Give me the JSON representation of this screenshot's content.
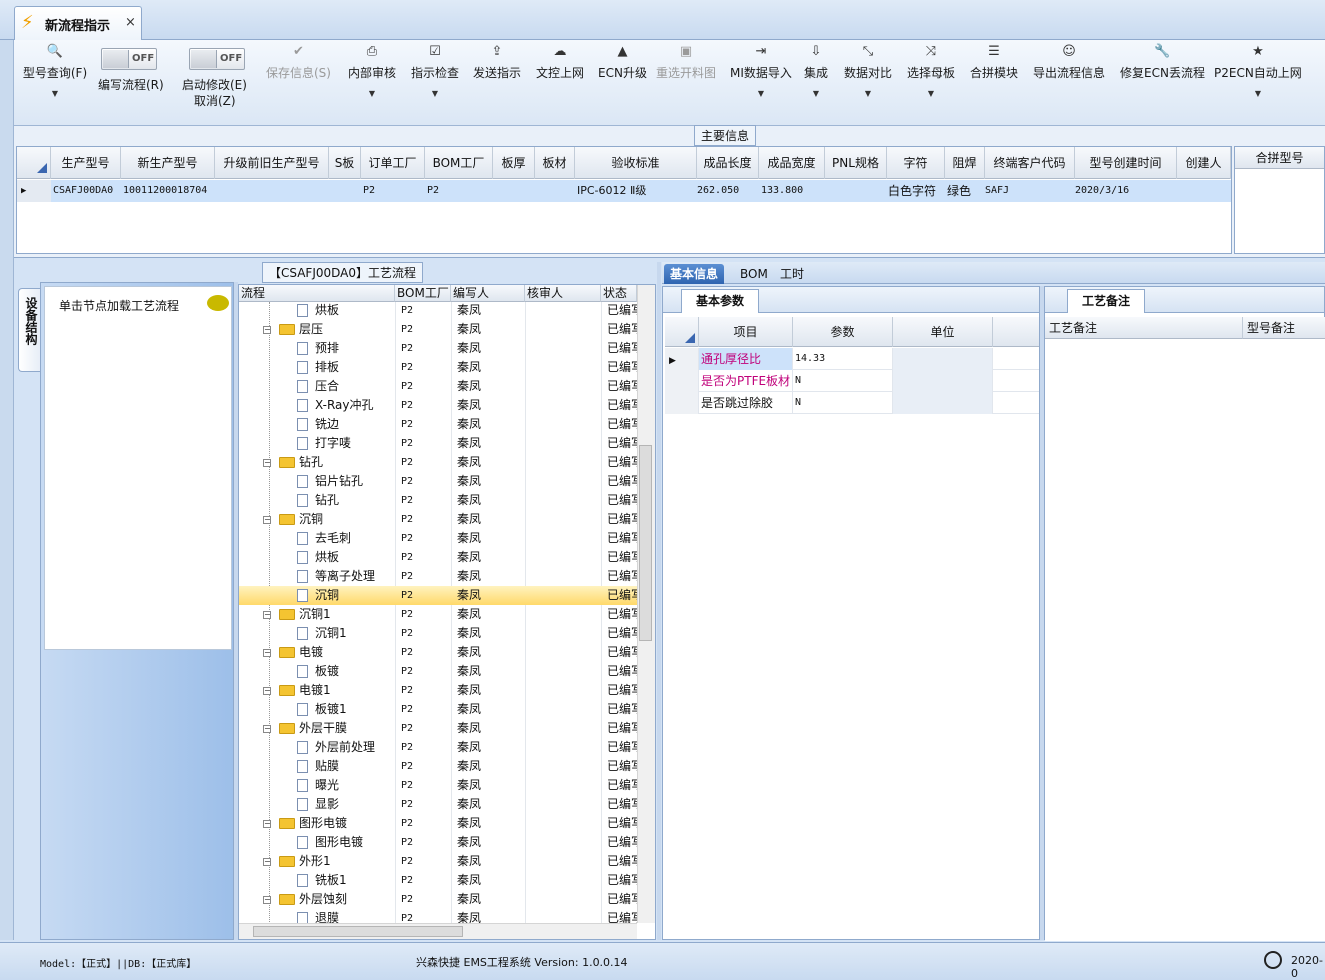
{
  "tab": {
    "title": "新流程指示",
    "close": "×"
  },
  "ribbon": {
    "buttons": [
      {
        "label": "型号查询(F)",
        "icon": "🔍",
        "disabled": false
      },
      {
        "label": "保存信息(S)",
        "icon": "✔",
        "disabled": true
      },
      {
        "label": "内部审核",
        "icon": "⎙",
        "disabled": false
      },
      {
        "label": "指示检查",
        "icon": "☑",
        "disabled": false
      },
      {
        "label": "发送指示",
        "icon": "⇪",
        "disabled": false
      },
      {
        "label": "文控上网",
        "icon": "☁",
        "disabled": false
      },
      {
        "label": "ECN升级",
        "icon": "▲",
        "disabled": false
      },
      {
        "label": "重选开料图",
        "icon": "▣",
        "disabled": true
      },
      {
        "label": "MI数据导入",
        "icon": "⇥",
        "disabled": false
      },
      {
        "label": "集成",
        "icon": "⇩",
        "disabled": false
      },
      {
        "label": "数据对比",
        "icon": "⤡",
        "disabled": false
      },
      {
        "label": "选择母板",
        "icon": "⤨",
        "disabled": false
      },
      {
        "label": "合拼模块",
        "icon": "☰",
        "disabled": false
      },
      {
        "label": "导出流程信息",
        "icon": "☺",
        "disabled": false
      },
      {
        "label": "修复ECN丢流程",
        "icon": "🔧",
        "disabled": false
      },
      {
        "label": "P2ECN自动上网",
        "icon": "★",
        "disabled": false
      }
    ],
    "toggle_off": "OFF",
    "write_flow": "编写流程(R)",
    "start_modify": "启动修改(E)",
    "cancel": "取消(Z)"
  },
  "main_info": {
    "title": "主要信息",
    "columns": [
      "生产型号",
      "新生产型号",
      "升级前旧生产型号",
      "S板",
      "订单工厂",
      "BOM工厂",
      "板厚",
      "板材",
      "验收标准",
      "成品长度",
      "成品宽度",
      "PNL规格",
      "字符",
      "阻焊",
      "终端客户代码",
      "型号创建时间",
      "创建人"
    ],
    "row": [
      "CSAFJ00DA0",
      "10011200018704",
      "",
      "",
      "P2",
      "P2",
      "",
      "",
      "IPC-6012 Ⅱ级",
      "262.050",
      "133.800",
      "",
      "白色字符",
      "绿色",
      "SAFJ",
      "2020/3/16",
      ""
    ],
    "merge_title": "合拼型号"
  },
  "equipment": {
    "tab_label": "设备结构",
    "hint": "单击节点加载工艺流程"
  },
  "process": {
    "title": "【CSAFJ00DA0】工艺流程",
    "columns": [
      "流程",
      "BOM工厂",
      "编写人",
      "核审人",
      "状态"
    ],
    "rows": [
      {
        "name": "烘板",
        "level": 2,
        "factory": "P2",
        "writer": "秦凤",
        "status": "已编写"
      },
      {
        "name": "层压",
        "level": 1,
        "factory": "P2",
        "writer": "秦凤",
        "status": "已编写"
      },
      {
        "name": "预排",
        "level": 2,
        "factory": "P2",
        "writer": "秦凤",
        "status": "已编写"
      },
      {
        "name": "排板",
        "level": 2,
        "factory": "P2",
        "writer": "秦凤",
        "status": "已编写"
      },
      {
        "name": "压合",
        "level": 2,
        "factory": "P2",
        "writer": "秦凤",
        "status": "已编写"
      },
      {
        "name": "X-Ray冲孔",
        "level": 2,
        "factory": "P2",
        "writer": "秦凤",
        "status": "已编写"
      },
      {
        "name": "铣边",
        "level": 2,
        "factory": "P2",
        "writer": "秦凤",
        "status": "已编写"
      },
      {
        "name": "打字唛",
        "level": 2,
        "factory": "P2",
        "writer": "秦凤",
        "status": "已编写"
      },
      {
        "name": "钻孔",
        "level": 1,
        "factory": "P2",
        "writer": "秦凤",
        "status": "已编写"
      },
      {
        "name": "铝片钻孔",
        "level": 2,
        "factory": "P2",
        "writer": "秦凤",
        "status": "已编写"
      },
      {
        "name": "钻孔",
        "level": 2,
        "factory": "P2",
        "writer": "秦凤",
        "status": "已编写"
      },
      {
        "name": "沉铜",
        "level": 1,
        "factory": "P2",
        "writer": "秦凤",
        "status": "已编写"
      },
      {
        "name": "去毛刺",
        "level": 2,
        "factory": "P2",
        "writer": "秦凤",
        "status": "已编写"
      },
      {
        "name": "烘板",
        "level": 2,
        "factory": "P2",
        "writer": "秦凤",
        "status": "已编写"
      },
      {
        "name": "等离子处理",
        "level": 2,
        "factory": "P2",
        "writer": "秦凤",
        "status": "已编写"
      },
      {
        "name": "沉铜",
        "level": 2,
        "factory": "P2",
        "writer": "秦凤",
        "status": "已编写",
        "selected": true
      },
      {
        "name": "沉铜1",
        "level": 1,
        "factory": "P2",
        "writer": "秦凤",
        "status": "已编写"
      },
      {
        "name": "沉铜1",
        "level": 2,
        "factory": "P2",
        "writer": "秦凤",
        "status": "已编写"
      },
      {
        "name": "电镀",
        "level": 1,
        "factory": "P2",
        "writer": "秦凤",
        "status": "已编写"
      },
      {
        "name": "板镀",
        "level": 2,
        "factory": "P2",
        "writer": "秦凤",
        "status": "已编写"
      },
      {
        "name": "电镀1",
        "level": 1,
        "factory": "P2",
        "writer": "秦凤",
        "status": "已编写"
      },
      {
        "name": "板镀1",
        "level": 2,
        "factory": "P2",
        "writer": "秦凤",
        "status": "已编写"
      },
      {
        "name": "外层干膜",
        "level": 1,
        "factory": "P2",
        "writer": "秦凤",
        "status": "已编写"
      },
      {
        "name": "外层前处理",
        "level": 2,
        "factory": "P2",
        "writer": "秦凤",
        "status": "已编写"
      },
      {
        "name": "贴膜",
        "level": 2,
        "factory": "P2",
        "writer": "秦凤",
        "status": "已编写"
      },
      {
        "name": "曝光",
        "level": 2,
        "factory": "P2",
        "writer": "秦凤",
        "status": "已编写"
      },
      {
        "name": "显影",
        "level": 2,
        "factory": "P2",
        "writer": "秦凤",
        "status": "已编写"
      },
      {
        "name": "图形电镀",
        "level": 1,
        "factory": "P2",
        "writer": "秦凤",
        "status": "已编写"
      },
      {
        "name": "图形电镀",
        "level": 2,
        "factory": "P2",
        "writer": "秦凤",
        "status": "已编写"
      },
      {
        "name": "外形1",
        "level": 1,
        "factory": "P2",
        "writer": "秦凤",
        "status": "已编写"
      },
      {
        "name": "铣板1",
        "level": 2,
        "factory": "P2",
        "writer": "秦凤",
        "status": "已编写"
      },
      {
        "name": "外层蚀刻",
        "level": 1,
        "factory": "P2",
        "writer": "秦凤",
        "status": "已编写"
      },
      {
        "name": "退膜",
        "level": 2,
        "factory": "P2",
        "writer": "秦凤",
        "status": "已编写"
      }
    ]
  },
  "detail": {
    "tabs": [
      "基本信息",
      "BOM",
      "工时"
    ],
    "basic_title": "基本参数",
    "columns": [
      "项目",
      "参数",
      "单位"
    ],
    "params": [
      {
        "item": "通孔厚径比",
        "value": "14.33",
        "unit": "",
        "color": "#c0007a"
      },
      {
        "item": "是否为PTFE板材",
        "value": "N",
        "unit": "",
        "color": "#c0007a"
      },
      {
        "item": "是否跳过除胶",
        "value": "N",
        "unit": "",
        "color": "#111111"
      }
    ],
    "notes_title": "工艺备注",
    "note_cols": [
      "工艺备注",
      "型号备注"
    ]
  },
  "status": {
    "model": "Model:【正式】||DB:【正式库】",
    "version": "兴森快捷 EMS工程系统 Version: 1.0.0.14",
    "date": "2020-0"
  }
}
